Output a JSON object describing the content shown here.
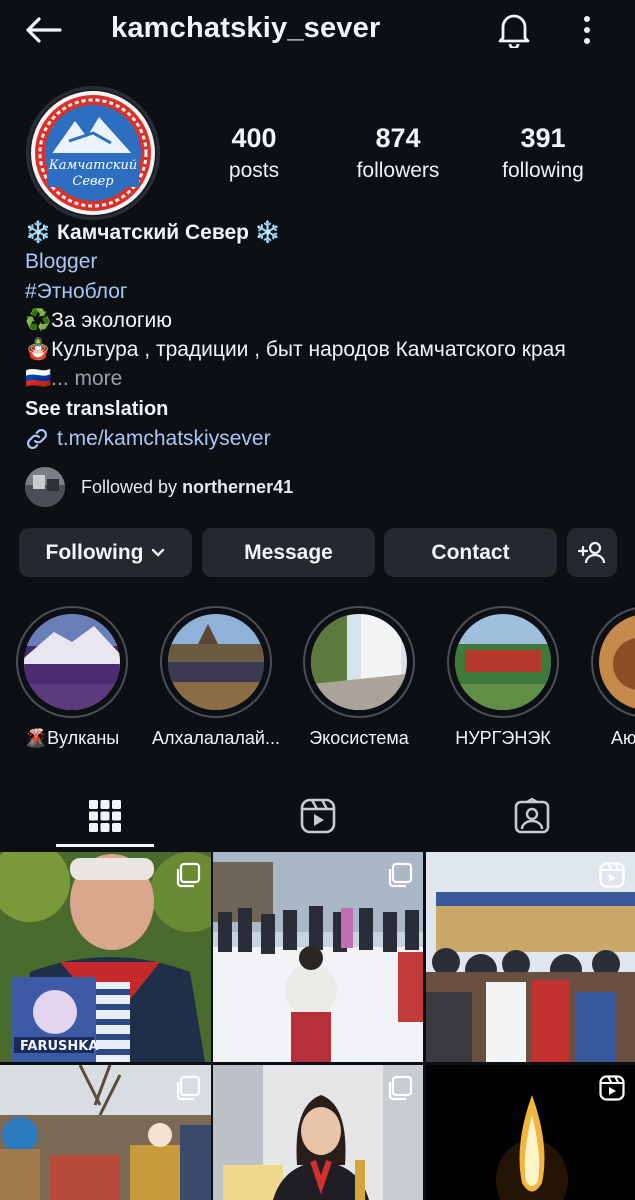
{
  "header": {
    "username": "kamchatskiy_sever"
  },
  "stats": {
    "posts": {
      "value": "400",
      "label": "posts"
    },
    "followers": {
      "value": "874",
      "label": "followers"
    },
    "following": {
      "value": "391",
      "label": "following"
    }
  },
  "avatar": {
    "logo_line1": "Камчатский",
    "logo_line2": "Север"
  },
  "bio": {
    "name": "❄️ Камчатский Север ❄️",
    "category": "Blogger",
    "hashtag": "#Этноблог",
    "line_ecology": "♻️За экологию",
    "line_culture": "🪆Культура , традиции , быт народов Камчатского края",
    "flag": "🇷🇺",
    "more": "... more",
    "see_translation": "See translation",
    "link": "t.me/kamchatskiysever"
  },
  "followed_by": {
    "prefix": "Followed by ",
    "user": "northerner41"
  },
  "buttons": {
    "following": "Following",
    "message": "Message",
    "contact": "Contact"
  },
  "highlights": [
    {
      "label": "🌋Вулканы"
    },
    {
      "label": "Алхалалалай..."
    },
    {
      "label": "Экосистема"
    },
    {
      "label": "НУРГЭНЭК"
    },
    {
      "label": "Аю"
    }
  ],
  "grid": {
    "post1_text": "FARUSHKA"
  },
  "colors": {
    "background": "#0c0f14",
    "button": "#25292f",
    "link": "#a9c7f2"
  }
}
